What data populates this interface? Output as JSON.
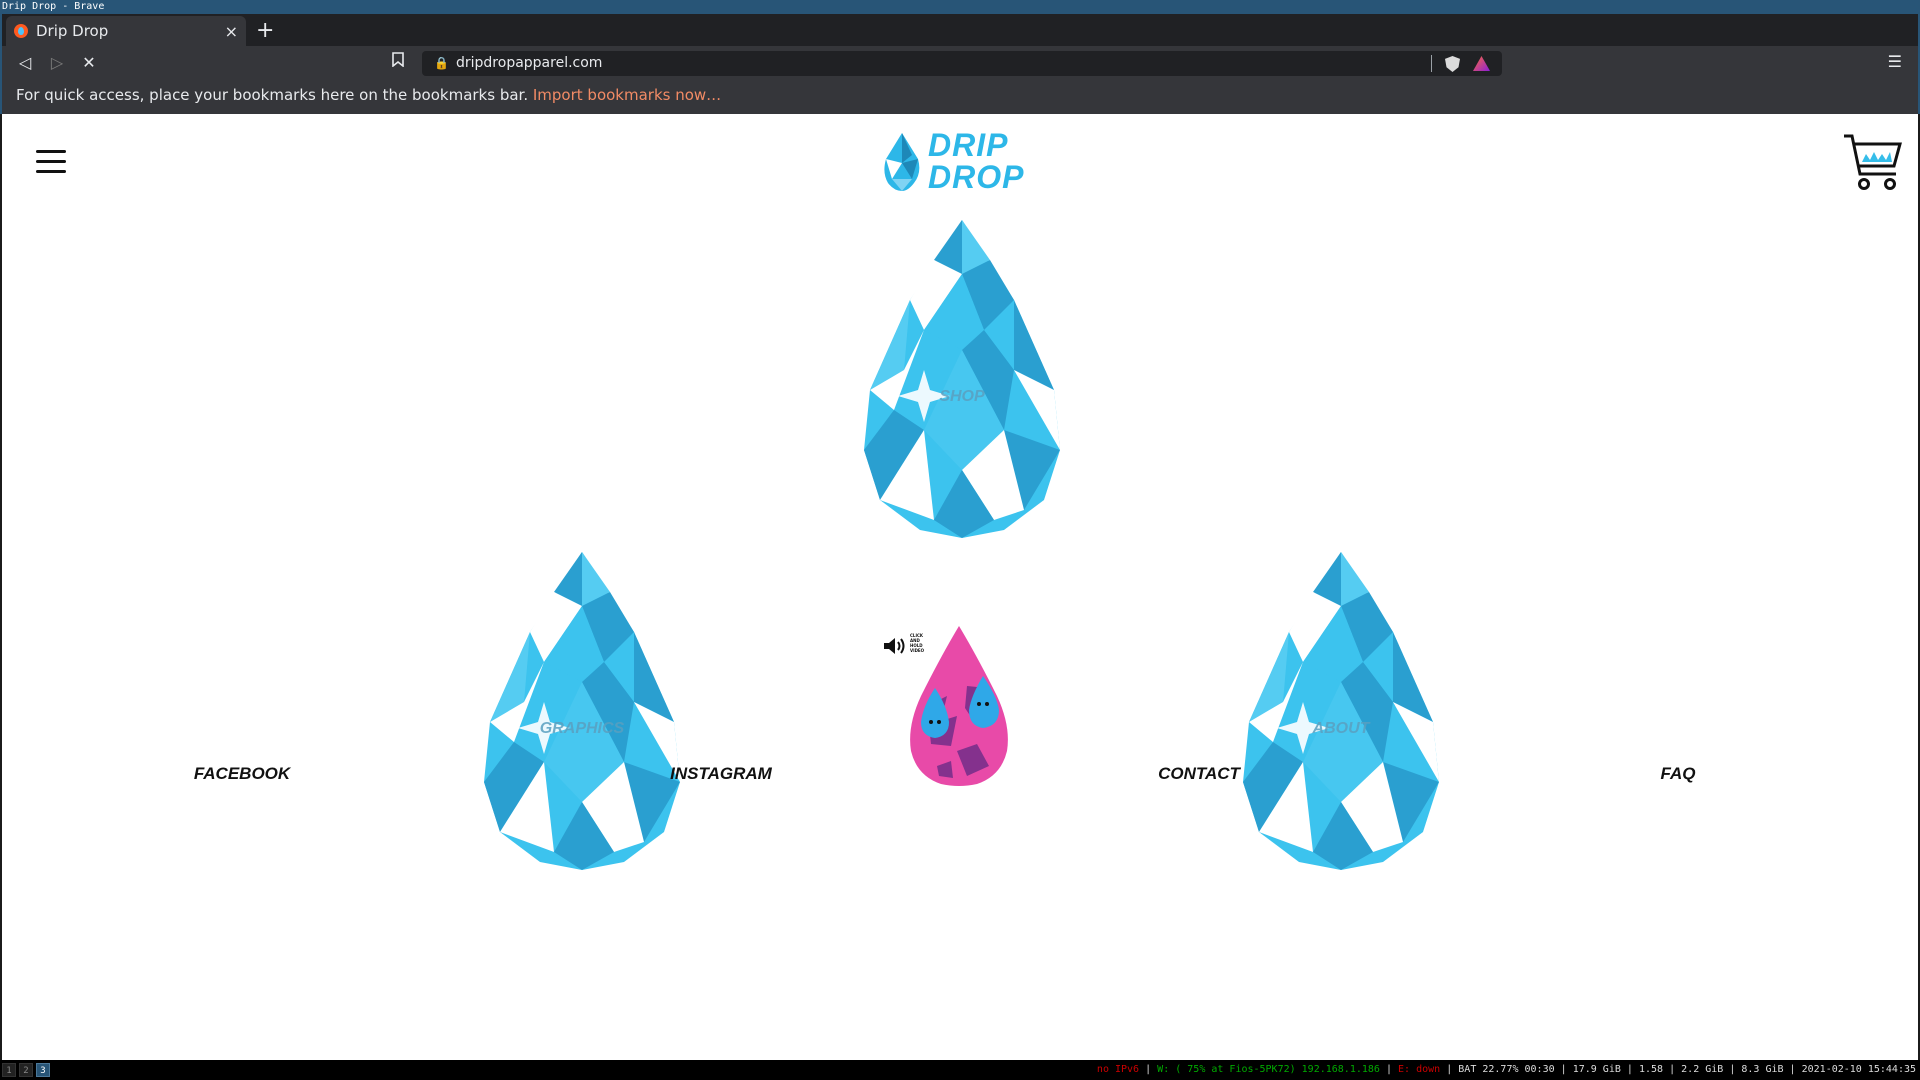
{
  "window": {
    "title": "Drip Drop - Brave"
  },
  "browser": {
    "tab": {
      "title": "Drip Drop",
      "close": "×"
    },
    "new_tab": "+",
    "back": "◁",
    "forward": "▷",
    "stop": "✕",
    "url": "dripdropapparel.com",
    "menu": "☰"
  },
  "bookmarks_bar": {
    "message": "For quick access, place your bookmarks here on the bookmarks bar.",
    "import_link": "Import bookmarks now…"
  },
  "page": {
    "logo": {
      "line1": "DRIP",
      "line2": "DROP"
    },
    "drops": {
      "shop": "SHOP",
      "graphics": "GRAPHICS",
      "about": "ABOUT"
    },
    "video": {
      "hint": "CLICK AND HOLD VIDEO"
    },
    "footer": {
      "facebook": "FACEBOOK",
      "instagram": "INSTAGRAM",
      "contact": "CONTACT",
      "faq": "FAQ"
    },
    "colors": {
      "drop_blue": "#3cc3ee",
      "drop_dark": "#2a9fd0",
      "video_pink": "#e84aa8"
    }
  },
  "statusbar": {
    "workspaces": [
      "1",
      "2",
      "3"
    ],
    "active_workspace": "3",
    "ipv6": "no IPv6",
    "wifi": "W: ( 75% at Fios-5PK72) 192.168.1.186",
    "eth": "E: down",
    "bat": "BAT 22.77% 00:30",
    "disk": "17.9 GiB",
    "load": "1.58",
    "mem": "2.2 GiB | 8.3 GiB",
    "datetime": "2021-02-10 15:44:35"
  }
}
